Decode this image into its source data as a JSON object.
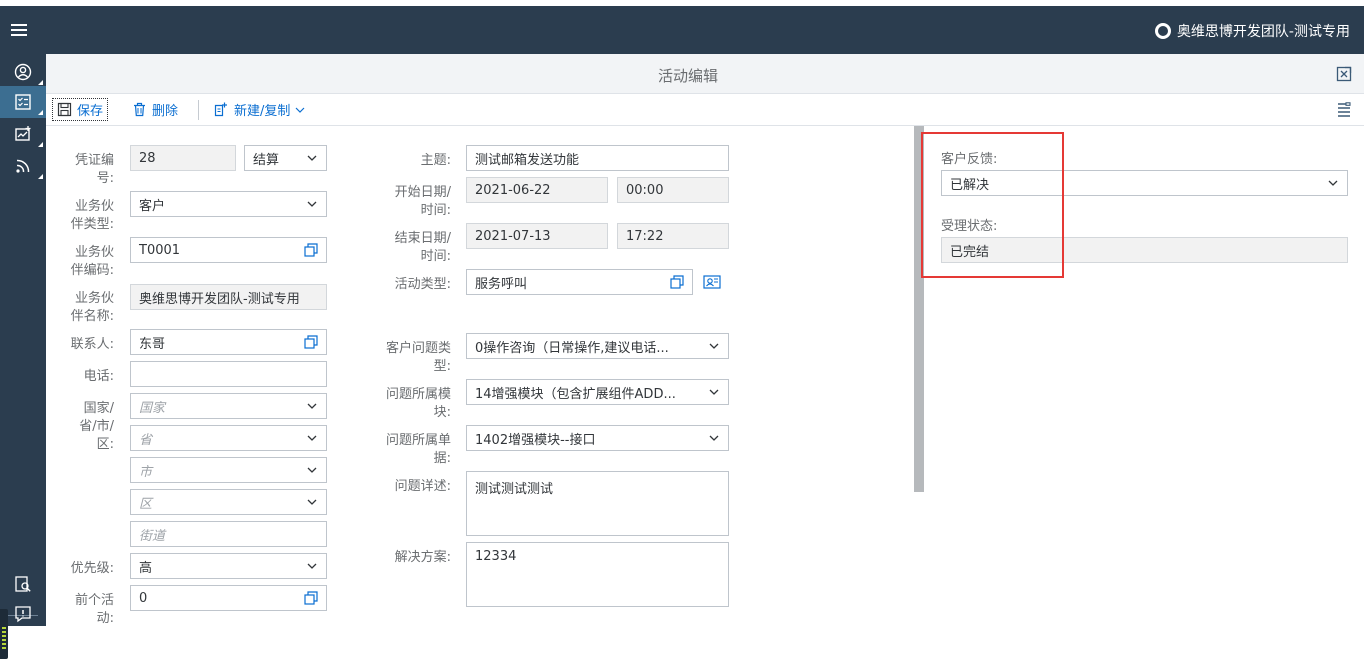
{
  "shell": {
    "company_name": "奥维思博开发团队-测试专用"
  },
  "header": {
    "title": "活动编辑"
  },
  "toolbar": {
    "save_label": "保存",
    "delete_label": "删除",
    "new_copy_label": "新建/复制"
  },
  "form_left": {
    "voucher_no_label": "凭证编\n号:",
    "voucher_no_value": "28",
    "voucher_status_value": "结算",
    "bp_type_label": "业务伙\n伴类型:",
    "bp_type_value": "客户",
    "bp_code_label": "业务伙\n伴编码:",
    "bp_code_value": "T0001",
    "bp_name_label": "业务伙\n伴名称:",
    "bp_name_value": "奥维思博开发团队-测试专用",
    "contact_label": "联系人:",
    "contact_value": "东哥",
    "phone_label": "电话:",
    "phone_value": "",
    "region_label": "国家/\n省/市/\n区:",
    "country_placeholder": "国家",
    "province_placeholder": "省",
    "city_placeholder": "市",
    "district_placeholder": "区",
    "street_placeholder": "街道",
    "priority_label": "优先级:",
    "priority_value": "高",
    "prev_activity_label": "前个活\n动:",
    "prev_activity_value": "0"
  },
  "form_mid": {
    "subject_label": "主题:",
    "subject_value": "测试邮箱发送功能",
    "start_label": "开始日期/\n时间:",
    "start_date": "2021-06-22",
    "start_time": "00:00",
    "end_label": "结束日期/\n时间:",
    "end_date": "2021-07-13",
    "end_time": "17:22",
    "activity_type_label": "活动类型:",
    "activity_type_value": "服务呼叫",
    "issue_type_label": "客户问题类\n型:",
    "issue_type_value": "0操作咨询（日常操作,建议电话...",
    "issue_module_label": "问题所属模\n块:",
    "issue_module_value": "14增强模块（包含扩展组件ADD...",
    "issue_doc_label": "问题所属单\n据:",
    "issue_doc_value": "1402增强模块--接口",
    "issue_detail_label": "问题详述:",
    "issue_detail_value": "测试测试测试",
    "solution_label": "解决方案:",
    "solution_value": "12334"
  },
  "form_right": {
    "feedback_label": "客户反馈:",
    "feedback_value": "已解决",
    "status_label": "受理状态:",
    "status_value": "已完结"
  },
  "colors": {
    "shell_bg": "#2b3d4f",
    "rail_active": "#3c6e91",
    "accent": "#0a6ed1",
    "highlight_box": "#e53935"
  }
}
